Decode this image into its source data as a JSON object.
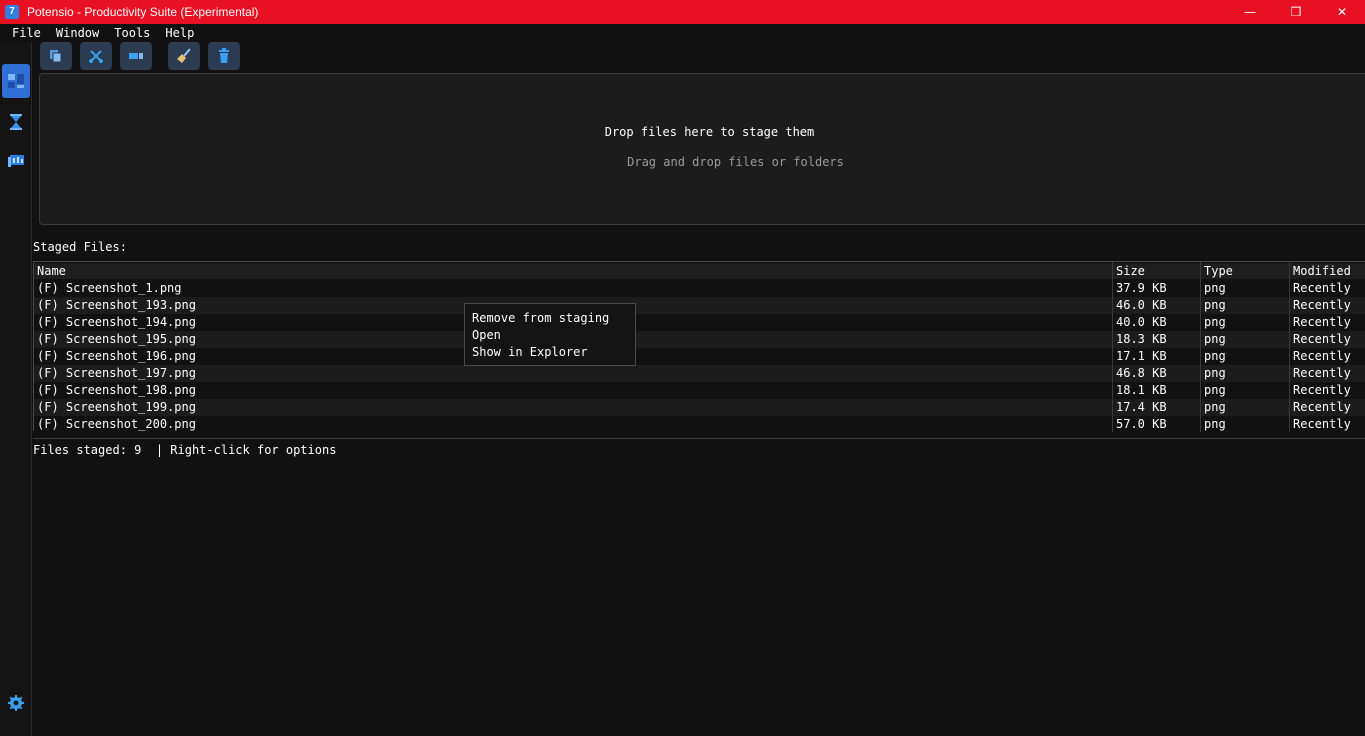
{
  "window": {
    "app_icon_glyph": "7",
    "title": "Potensio - Productivity Suite (Experimental)",
    "minimize_glyph": "—",
    "restore_glyph": "❐",
    "close_glyph": "✕"
  },
  "menu": [
    "File",
    "Window",
    "Tools",
    "Help"
  ],
  "sidebar": {
    "items": [
      {
        "icon": "dashboard-icon",
        "active": true
      },
      {
        "icon": "hourglass-icon",
        "active": false
      },
      {
        "icon": "display-icon",
        "active": false
      }
    ],
    "bottom_icon": "settings-gear-icon"
  },
  "toolbar": {
    "buttons": [
      {
        "icon": "copy-icon"
      },
      {
        "icon": "scissors-icon"
      },
      {
        "icon": "move-icon"
      },
      {
        "icon": "broom-icon"
      },
      {
        "icon": "trash-icon"
      }
    ]
  },
  "dropzone": {
    "title": "Drop files here to stage them",
    "subtitle": "Drag and drop files or folders"
  },
  "staged_label": "Staged Files:",
  "table": {
    "columns": [
      "Name",
      "Size",
      "Type",
      "Modified"
    ],
    "rows": [
      {
        "name": "(F) Screenshot_1.png",
        "size": "37.9 KB",
        "type": "png",
        "modified": "Recently"
      },
      {
        "name": "(F) Screenshot_193.png",
        "size": "46.0 KB",
        "type": "png",
        "modified": "Recently"
      },
      {
        "name": "(F) Screenshot_194.png",
        "size": "40.0 KB",
        "type": "png",
        "modified": "Recently"
      },
      {
        "name": "(F) Screenshot_195.png",
        "size": "18.3 KB",
        "type": "png",
        "modified": "Recently"
      },
      {
        "name": "(F) Screenshot_196.png",
        "size": "17.1 KB",
        "type": "png",
        "modified": "Recently"
      },
      {
        "name": "(F) Screenshot_197.png",
        "size": "46.8 KB",
        "type": "png",
        "modified": "Recently"
      },
      {
        "name": "(F) Screenshot_198.png",
        "size": "18.1 KB",
        "type": "png",
        "modified": "Recently"
      },
      {
        "name": "(F) Screenshot_199.png",
        "size": "17.4 KB",
        "type": "png",
        "modified": "Recently"
      },
      {
        "name": "(F) Screenshot_200.png",
        "size": "57.0 KB",
        "type": "png",
        "modified": "Recently"
      }
    ]
  },
  "status": "Files staged: 9  | Right-click for options",
  "context_menu": [
    "Remove from staging",
    "Open",
    "Show in Explorer"
  ],
  "colors": {
    "titlebar": "#e81123",
    "accent": "#2f6fd6",
    "background": "#111111"
  }
}
